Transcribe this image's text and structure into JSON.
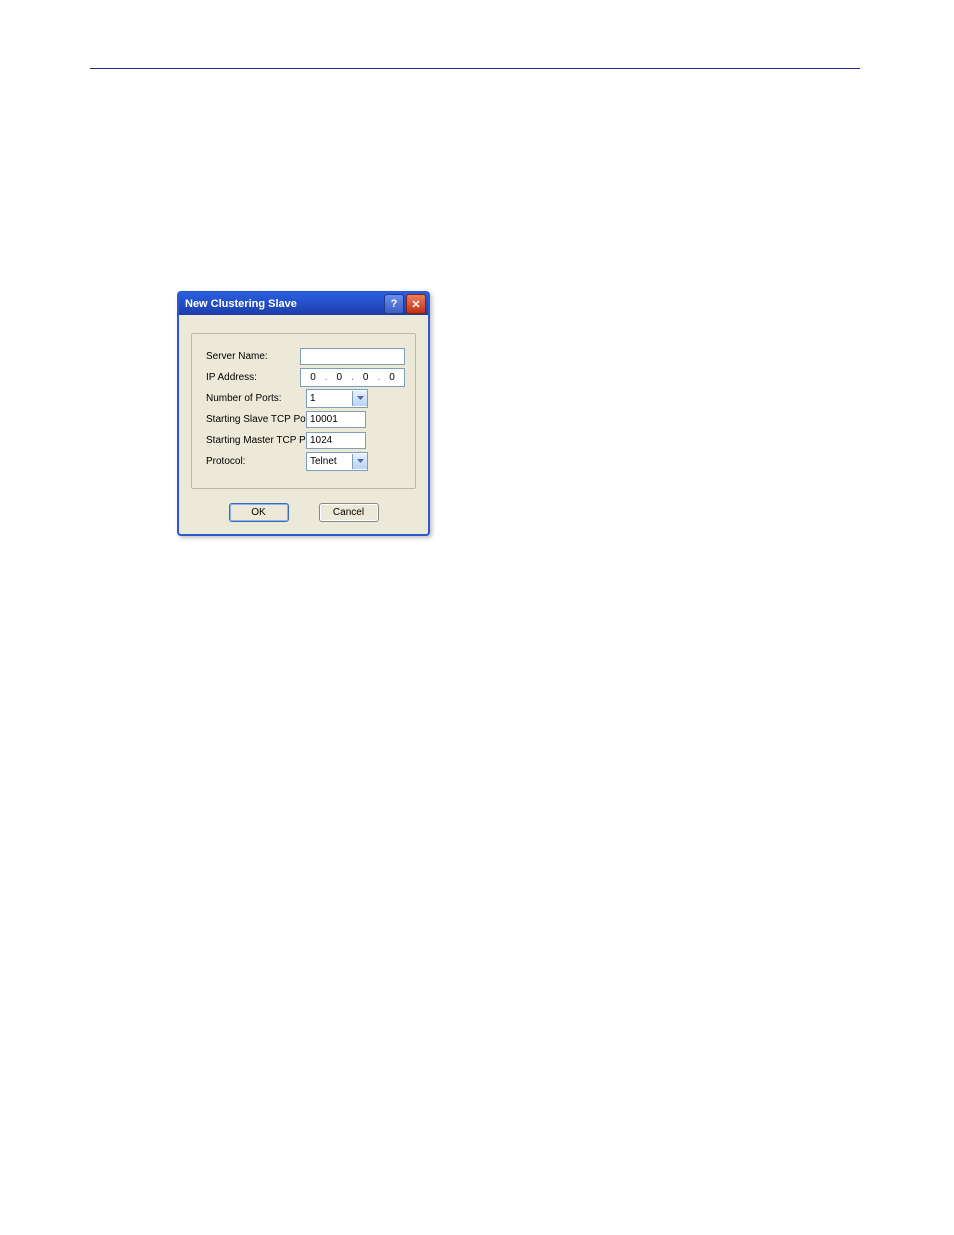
{
  "dialog": {
    "title": "New Clustering Slave",
    "fields": {
      "server_name": {
        "label": "Server Name:",
        "value": ""
      },
      "ip_address": {
        "label": "IP Address:",
        "octets": [
          "0",
          "0",
          "0",
          "0"
        ]
      },
      "num_ports": {
        "label": "Number of Ports:",
        "value": "1"
      },
      "slave_port": {
        "label": "Starting Slave TCP Port:",
        "value": "10001"
      },
      "master_port": {
        "label": "Starting Master TCP Port:",
        "value": "1024"
      },
      "protocol": {
        "label": "Protocol:",
        "value": "Telnet"
      }
    },
    "buttons": {
      "ok": "OK",
      "cancel": "Cancel"
    }
  }
}
